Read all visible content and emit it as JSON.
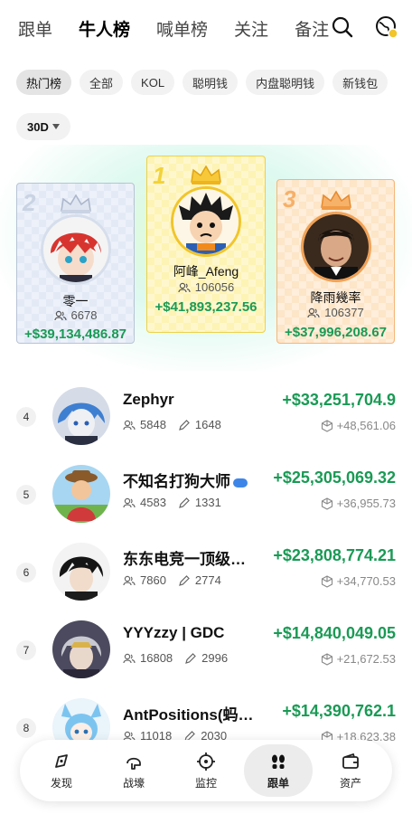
{
  "nav": {
    "tabs": [
      "跟单",
      "牛人榜",
      "喊单榜",
      "关注",
      "备注"
    ],
    "active_tab": "牛人榜",
    "search_icon": "search-icon",
    "globe_icon": "globe-icon"
  },
  "filters": {
    "chips": [
      "热门榜",
      "全部",
      "KOL",
      "聪明钱",
      "内盘聪明钱",
      "新钱包"
    ],
    "active_chip": "热门榜",
    "period": "30D"
  },
  "podium": [
    {
      "rank": "2",
      "name": "零一",
      "followers": "6678",
      "pnl": "+$39,134,486.87",
      "accent": "#b7c3d6"
    },
    {
      "rank": "1",
      "name": "阿峰_Afeng",
      "followers": "106056",
      "pnl": "+$41,893,237.56",
      "accent": "#ecd24a"
    },
    {
      "rank": "3",
      "name": "降雨幾率",
      "followers": "106377",
      "pnl": "+$37,996,208.67",
      "accent": "#f5b679"
    }
  ],
  "rows": [
    {
      "rank": "4",
      "name": "Zephyr",
      "followers": "5848",
      "posts": "1648",
      "pnl": "+$33,251,704.9",
      "sub": "+48,561.06"
    },
    {
      "rank": "5",
      "name": "不知名打狗大师",
      "followers": "4583",
      "posts": "1331",
      "pnl": "+$25,305,069.32",
      "sub": "+36,955.73"
    },
    {
      "rank": "6",
      "name": "东东电竞一顶级…",
      "followers": "7860",
      "posts": "2774",
      "pnl": "+$23,808,774.21",
      "sub": "+34,770.53"
    },
    {
      "rank": "7",
      "name": "YYYzzy | GDC",
      "followers": "16808",
      "posts": "2996",
      "pnl": "+$14,840,049.05",
      "sub": "+21,672.53"
    },
    {
      "rank": "8",
      "name": "AntPositions(蚂…",
      "followers": "11018",
      "posts": "2030",
      "pnl": "+$14,390,762.1",
      "sub": "+18,623.38"
    }
  ],
  "bottom_nav": [
    {
      "label": "发现",
      "icon": "compass-icon"
    },
    {
      "label": "战壕",
      "icon": "helmet-icon"
    },
    {
      "label": "监控",
      "icon": "target-icon"
    },
    {
      "label": "跟单",
      "icon": "footprints-icon"
    },
    {
      "label": "资产",
      "icon": "wallet-icon"
    }
  ],
  "active_bottom": "跟单",
  "colors": {
    "pnl_green": "#1a9a55",
    "gold": "#ecd24a"
  }
}
